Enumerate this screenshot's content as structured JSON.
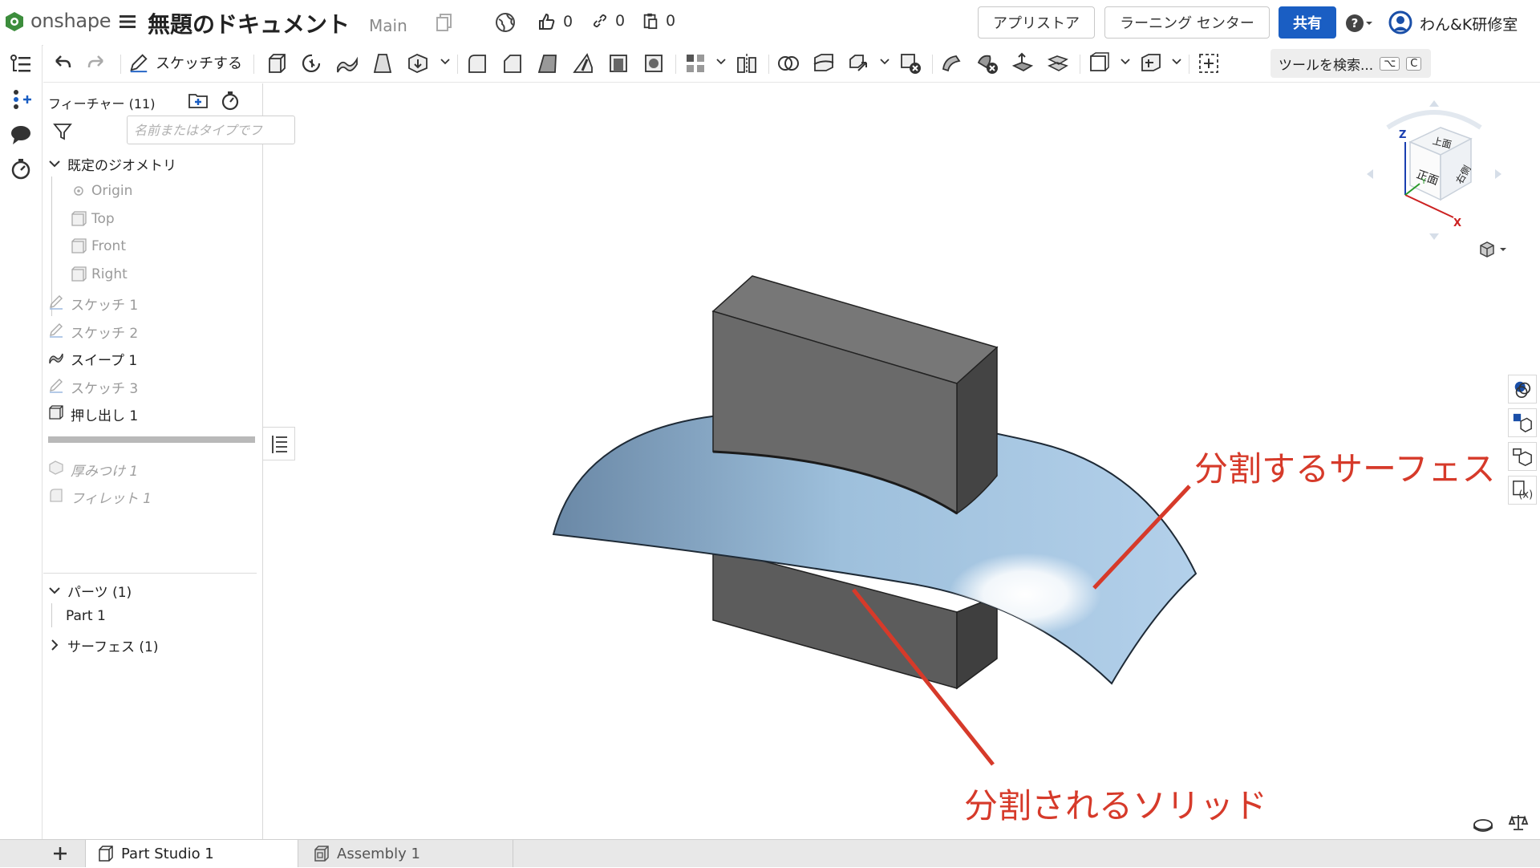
{
  "app": {
    "logo_text": "onshape"
  },
  "document": {
    "title": "無題のドキュメント",
    "branch": "Main"
  },
  "stats": {
    "likes": "0",
    "links": "0",
    "copies": "0"
  },
  "header_buttons": {
    "app_store": "アプリストア",
    "learning_center": "ラーニング センター",
    "share": "共有",
    "user_name": "わん&K研修室"
  },
  "toolbar": {
    "sketch_label": "スケッチする",
    "search_label": "ツールを検索...",
    "search_shortcut_1": "⌥",
    "search_shortcut_2": "C"
  },
  "features": {
    "header": "フィーチャー (11)",
    "filter_placeholder": "名前またはタイプでフ",
    "default_geometry": "既定のジオメトリ",
    "items": [
      {
        "label": "Origin",
        "type": "origin",
        "state": "muted"
      },
      {
        "label": "Top",
        "type": "plane",
        "state": "muted"
      },
      {
        "label": "Front",
        "type": "plane",
        "state": "muted"
      },
      {
        "label": "Right",
        "type": "plane",
        "state": "muted"
      },
      {
        "label": "スケッチ 1",
        "type": "sketch",
        "state": "muted"
      },
      {
        "label": "スケッチ 2",
        "type": "sketch",
        "state": "muted"
      },
      {
        "label": "スイープ 1",
        "type": "sweep",
        "state": "active"
      },
      {
        "label": "スケッチ 3",
        "type": "sketch",
        "state": "muted"
      },
      {
        "label": "押し出し 1",
        "type": "extrude",
        "state": "active"
      },
      {
        "label": "厚みつけ 1",
        "type": "thicken",
        "state": "rolledback"
      },
      {
        "label": "フィレット 1",
        "type": "fillet",
        "state": "rolledback"
      }
    ]
  },
  "parts": {
    "header": "パーツ (1)",
    "items": [
      "Part 1"
    ],
    "surfaces_header": "サーフェス (1)"
  },
  "tabs": [
    {
      "label": "Part Studio 1",
      "active": true
    },
    {
      "label": "Assembly 1",
      "active": false
    }
  ],
  "viewcube": {
    "top": "上面",
    "front": "正面",
    "right": "右側",
    "axis_z": "Z",
    "axis_x": "X",
    "axis_y": "Y"
  },
  "annotations": {
    "surface": "分割するサーフェス",
    "solid": "分割されるソリッド"
  },
  "colors": {
    "accent": "#1a5ec3",
    "annotation": "#d63a2a",
    "surface": "#a9c9e3",
    "solid": "#5f5f5f"
  }
}
